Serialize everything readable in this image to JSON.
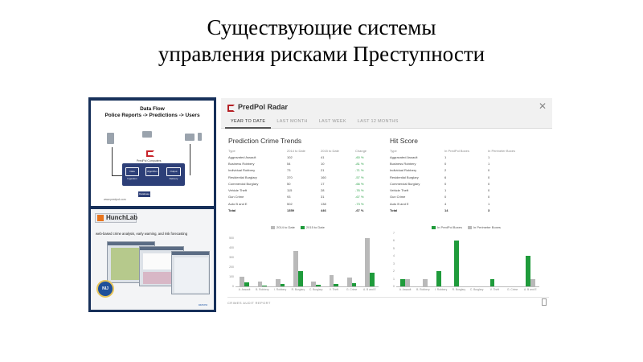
{
  "slide": {
    "title_line1": "Существующие системы",
    "title_line2": "управления рисками Преступности"
  },
  "dataflow": {
    "title": "Data Flow",
    "subtitle": "Police Reports -> Predictions -> Users",
    "cpu_label": "PredPol Computers",
    "box_labels": [
      "Data Ingestion",
      "Algorithm",
      "Output Delivery",
      "Database"
    ],
    "footer": "www.predpol.com"
  },
  "hunchlab": {
    "logo_text": "HunchLab",
    "subtitle": "web-based crime analysis, early warning, and risk forecasting",
    "badge": "NIJ",
    "footer": "azavea"
  },
  "radar": {
    "title": "PredPol Radar",
    "tabs": [
      "YEAR TO DATE",
      "LAST MONTH",
      "LAST WEEK",
      "LAST 12 MONTHS"
    ],
    "trends_title": "Prediction Crime Trends",
    "trends_headers": [
      "Type",
      "2014 to Date",
      "2015 to Date",
      "Change"
    ],
    "trends_rows": [
      [
        "Aggravated Assault",
        "102",
        "41",
        "-60 %"
      ],
      [
        "Business Robbery",
        "54",
        "10",
        "-81 %"
      ],
      [
        "Individual Robbery",
        "73",
        "21",
        "-71 %"
      ],
      [
        "Residential Burglary",
        "370",
        "160",
        "-57 %"
      ],
      [
        "Commercial Burglary",
        "50",
        "17",
        "-66 %"
      ],
      [
        "Vehicle Theft",
        "115",
        "28",
        "-76 %"
      ],
      [
        "Gun Crime",
        "93",
        "31",
        "-67 %"
      ],
      [
        "Auto B and E",
        "502",
        "138",
        "-73 %"
      ],
      [
        "Total",
        "1359",
        "446",
        "-67 %"
      ]
    ],
    "hit_title": "Hit Score",
    "hit_headers": [
      "Type",
      "In PredPol Boxes",
      "In Perimeter Boxes"
    ],
    "hit_rows": [
      [
        "Aggravated Assault",
        "1",
        "1"
      ],
      [
        "Business Robbery",
        "0",
        "1"
      ],
      [
        "Individual Robbery",
        "2",
        "0"
      ],
      [
        "Residential Burglary",
        "6",
        "0"
      ],
      [
        "Commercial Burglary",
        "0",
        "0"
      ],
      [
        "Vehicle Theft",
        "1",
        "0"
      ],
      [
        "Gun Crime",
        "0",
        "0"
      ],
      [
        "Auto B and E",
        "4",
        "1"
      ],
      [
        "Total",
        "14",
        "3"
      ]
    ],
    "footer": "CRIMES AUDIT REPORT"
  },
  "colors": {
    "gray": "#b9b9b9",
    "green": "#1f9b3b",
    "brand": "#b52025"
  },
  "chart_data": [
    {
      "type": "bar",
      "categories": [
        "A. Assault",
        "B. Robbery",
        "I. Robbery",
        "R. Burglary",
        "C. Burglary",
        "V. Theft",
        "G. Crime",
        "A. B and E"
      ],
      "series": [
        {
          "name": "2014 to Date",
          "values": [
            102,
            54,
            73,
            370,
            50,
            115,
            93,
            502
          ]
        },
        {
          "name": "2015 to Date",
          "values": [
            41,
            10,
            21,
            160,
            17,
            28,
            31,
            138
          ]
        }
      ],
      "yticks": [
        0,
        100,
        200,
        300,
        400,
        500
      ],
      "ylim": [
        0,
        550
      ],
      "grid": false,
      "legend": "top"
    },
    {
      "type": "bar",
      "categories": [
        "A. Assault",
        "B. Robbery",
        "I. Robbery",
        "R. Burglary",
        "C. Burglary",
        "V. Theft",
        "G. Crime",
        "A. B and E"
      ],
      "series": [
        {
          "name": "In PredPol Boxes",
          "values": [
            1,
            0,
            2,
            6,
            0,
            1,
            0,
            4
          ]
        },
        {
          "name": "In Perimeter Boxes",
          "values": [
            1,
            1,
            0,
            0,
            0,
            0,
            0,
            1
          ]
        }
      ],
      "yticks": [
        0,
        1,
        2,
        3,
        4,
        5,
        6,
        7
      ],
      "ylim": [
        0,
        7
      ],
      "grid": false,
      "legend": "top"
    }
  ]
}
